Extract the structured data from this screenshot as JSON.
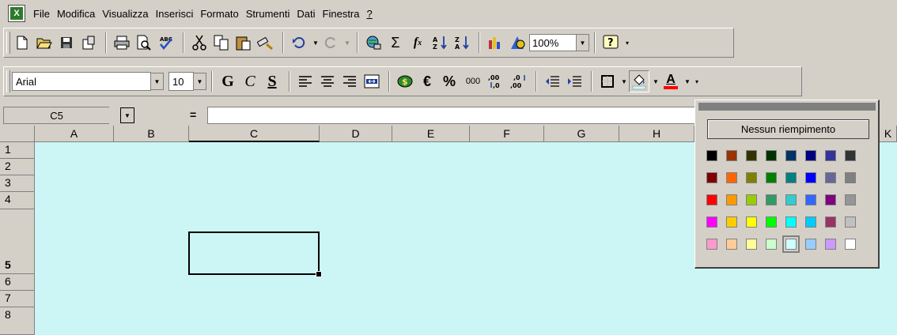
{
  "menubar": {
    "items": [
      "File",
      "Modifica",
      "Visualizza",
      "Inserisci",
      "Formato",
      "Strumenti",
      "Dati",
      "Finestra",
      "?"
    ]
  },
  "standard_toolbar": {
    "zoom": "100%"
  },
  "format_toolbar": {
    "font": "Arial",
    "size": "10",
    "bold": "G",
    "italic": "C",
    "underline": "S",
    "euro": "€",
    "percent": "%",
    "thousands": "000",
    "dec_increase": ",00 ,0",
    "dec_decrease": ",0 ,00",
    "font_color_letter": "A",
    "font_color": "#ff0000"
  },
  "formula_bar": {
    "cell_ref": "C5",
    "equals": "="
  },
  "columns": [
    "A",
    "B",
    "C",
    "D",
    "E",
    "F",
    "G",
    "H",
    "K"
  ],
  "rows": [
    "1",
    "2",
    "3",
    "4",
    "5",
    "6",
    "7",
    "8"
  ],
  "sheet_color": "#ccf6f6",
  "palette": {
    "no_fill_label": "Nessun riempimento",
    "colors": [
      "#000000",
      "#993300",
      "#333300",
      "#003300",
      "#003366",
      "#000080",
      "#333399",
      "#333333",
      "#800000",
      "#ff6600",
      "#808000",
      "#008000",
      "#008080",
      "#0000ff",
      "#666699",
      "#808080",
      "#ff0000",
      "#ff9900",
      "#99cc00",
      "#339966",
      "#33cccc",
      "#3366ff",
      "#800080",
      "#969696",
      "#ff00ff",
      "#ffcc00",
      "#ffff00",
      "#00ff00",
      "#00ffff",
      "#00ccff",
      "#993366",
      "#c0c0c0",
      "#ff99cc",
      "#ffcc99",
      "#ffff99",
      "#ccffcc",
      "#ccffff",
      "#99ccff",
      "#cc99ff",
      "#ffffff"
    ],
    "selected_index": 36
  }
}
